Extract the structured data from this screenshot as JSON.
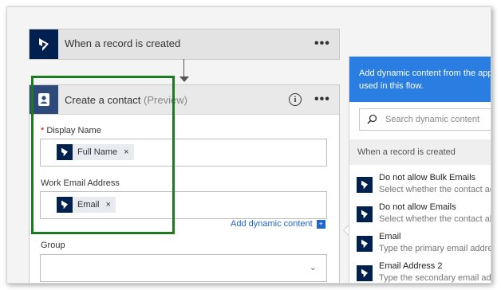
{
  "trigger_card": {
    "title": "When a record is created",
    "menu": "•••"
  },
  "action_card": {
    "title": "Create a contact",
    "subtitle": "(Preview)",
    "menu": "•••",
    "info_glyph": "i",
    "fields": {
      "display_name": {
        "required_mark": "*",
        "label": "Display Name",
        "token": "Full Name",
        "remove": "×"
      },
      "work_email": {
        "label": "Work Email Address",
        "token": "Email",
        "remove": "×"
      },
      "group": {
        "label": "Group",
        "chevron": "⌄"
      }
    },
    "add_dynamic": {
      "label": "Add dynamic content",
      "icon_glyph": "+"
    }
  },
  "dynamic_panel": {
    "header_line1": "Add dynamic content from the apps",
    "header_line2": "used in this flow.",
    "search_placeholder": "Search dynamic content",
    "section_title": "When a record is created",
    "items": [
      {
        "title": "Do not allow Bulk Emails",
        "subtitle": "Select whether the contact accep"
      },
      {
        "title": "Do not allow Emails",
        "subtitle": "Select whether the contact allows"
      },
      {
        "title": "Email",
        "subtitle": "Type the primary email address f"
      },
      {
        "title": "Email Address 2",
        "subtitle": "Type the secondary email address"
      }
    ]
  },
  "colors": {
    "dynamics_navy": "#002050",
    "contact_blue": "#2d4a7a",
    "panel_blue": "#2a7de1",
    "highlight_green": "#1e7a1e",
    "link_blue": "#2266c8"
  },
  "icons": {
    "dynamics": "dynamics-365-icon",
    "contact": "contact-card-icon",
    "search": "search-icon",
    "info": "info-icon"
  }
}
